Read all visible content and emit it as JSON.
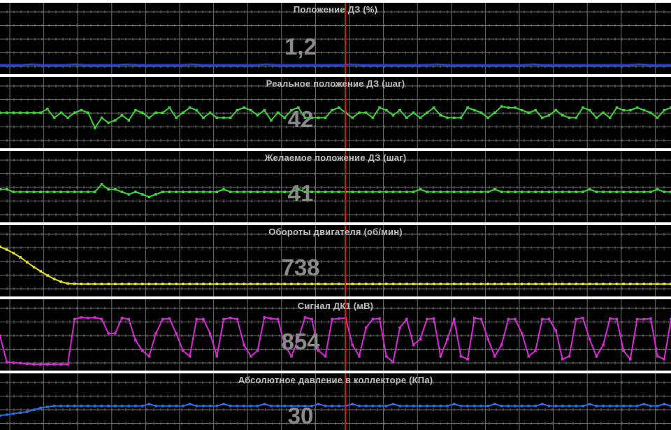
{
  "colors": {
    "background": "#000000",
    "grid": "#6e6e6e",
    "separator": "#ffffff",
    "cursor": "#e01010",
    "title": "#bdbdbd",
    "value": "#8a8a8a"
  },
  "panels": [
    {
      "title": "Положение ДЗ  (%)",
      "value": "1,2",
      "color": "#1c3fe6",
      "marker": false,
      "ymin": 0,
      "ymax": 10,
      "data": [
        1,
        1,
        1,
        1.1,
        1,
        1,
        1,
        1.1,
        1,
        1,
        1,
        1,
        1.1,
        1,
        1,
        1,
        1,
        1,
        1.1,
        1,
        1,
        1,
        1,
        1,
        1,
        1.1,
        1,
        1,
        1,
        1,
        1,
        1,
        1,
        1.1,
        1,
        1,
        1,
        1,
        1,
        1,
        1,
        1.1,
        1,
        1,
        1,
        1,
        1,
        1,
        1,
        1,
        1.1,
        1,
        1,
        1,
        1,
        1,
        1,
        1,
        1,
        1,
        1.1,
        1,
        1,
        1
      ]
    },
    {
      "title": "Реальное положение ДЗ  (шаг)",
      "value": "42",
      "color": "#3fd23a",
      "marker": true,
      "ymin": 30,
      "ymax": 55,
      "data": [
        43,
        43,
        43,
        43,
        43,
        43,
        43,
        44.5,
        41,
        43,
        41,
        43,
        44,
        43,
        37,
        41,
        39,
        40,
        42,
        40,
        44,
        43,
        41,
        43,
        43,
        45,
        41,
        43,
        45,
        44,
        41,
        43,
        41,
        41,
        41,
        44,
        45,
        44,
        42,
        44,
        40,
        43,
        41,
        44,
        45,
        41,
        41,
        41,
        41,
        44,
        45,
        43,
        41,
        43,
        43,
        41,
        45,
        44,
        42,
        44,
        41,
        43,
        41,
        43,
        45,
        42,
        41,
        41,
        41,
        45,
        44,
        43,
        41,
        43,
        45.5,
        45,
        45,
        44,
        43,
        44,
        41,
        42,
        44,
        42,
        41,
        41,
        45,
        44,
        41,
        43,
        41,
        45,
        44,
        44,
        45,
        44,
        43,
        41,
        44,
        45
      ]
    },
    {
      "title": "Желаемое положение ДЗ  (шаг)",
      "value": "41",
      "color": "#3fd23a",
      "marker": true,
      "ymin": 30,
      "ymax": 55,
      "data": [
        42,
        42,
        41,
        41,
        41,
        41,
        41,
        41,
        41,
        41,
        41,
        41,
        41,
        41,
        41,
        44,
        42,
        42,
        41,
        40,
        41,
        40,
        39,
        40,
        41,
        41,
        41,
        41,
        41,
        41,
        41,
        41,
        41,
        42,
        41,
        41,
        41,
        41,
        41,
        41,
        41,
        41,
        41,
        41,
        42,
        41,
        41,
        41,
        41,
        41,
        41,
        41,
        41,
        41,
        41,
        41,
        41,
        41,
        41,
        41,
        41,
        41,
        42,
        41,
        41,
        41,
        41,
        41,
        41,
        41,
        41,
        41,
        41,
        42,
        41,
        41,
        41,
        41,
        41,
        41,
        41,
        41,
        41,
        41,
        41,
        41,
        41,
        42,
        41,
        41,
        41,
        41,
        41,
        41,
        41,
        41,
        41,
        42,
        41,
        41
      ]
    },
    {
      "title": "Обороты двигателя  (об/мин)",
      "value": "738",
      "color": "#e6e21c",
      "marker": true,
      "ymin": 600,
      "ymax": 1500,
      "data": [
        1270,
        1230,
        1180,
        1120,
        1050,
        980,
        920,
        860,
        810,
        770,
        745,
        740,
        738,
        738,
        738,
        738,
        738,
        738,
        738,
        738,
        738,
        738,
        738,
        738,
        738,
        738,
        738,
        738,
        738,
        738,
        738,
        738,
        738,
        738,
        738,
        738,
        738,
        738,
        738,
        738,
        738,
        738,
        738,
        738,
        738,
        738,
        738,
        738,
        738,
        738,
        738,
        738,
        738,
        738,
        738,
        738,
        738,
        738,
        738,
        738,
        738,
        738,
        738,
        738,
        738,
        738,
        738,
        738,
        738,
        738,
        738,
        738,
        738,
        738,
        738,
        738,
        738,
        738,
        738,
        738,
        738,
        738,
        738,
        738,
        738,
        738,
        738,
        738,
        738,
        738,
        738,
        738,
        738,
        738,
        738,
        738,
        738,
        738,
        738,
        738
      ]
    },
    {
      "title": "Сигнал ДК1  (мВ)",
      "value": "854",
      "color": "#d62ad6",
      "marker": true,
      "ymin": 0,
      "ymax": 1100,
      "data": [
        560,
        100,
        90,
        80,
        70,
        60,
        60,
        60,
        60,
        60,
        60,
        850,
        880,
        870,
        880,
        850,
        600,
        600,
        870,
        850,
        480,
        300,
        200,
        600,
        850,
        860,
        600,
        300,
        200,
        850,
        850,
        600,
        200,
        850,
        870,
        850,
        400,
        200,
        300,
        880,
        860,
        850,
        400,
        200,
        500,
        880,
        850,
        300,
        200,
        850,
        860,
        870,
        400,
        200,
        700,
        850,
        860,
        200,
        100,
        700,
        850,
        400,
        500,
        850,
        860,
        200,
        500,
        850,
        200,
        150,
        870,
        850,
        500,
        200,
        400,
        850,
        850,
        600,
        200,
        300,
        850,
        850,
        650,
        150,
        200,
        850,
        870,
        500,
        200,
        400,
        860,
        850,
        300,
        150,
        850,
        850,
        860,
        200,
        150,
        850
      ]
    },
    {
      "title": "Абсолютное давление в коллекторе  (КПа)",
      "value": "30",
      "color": "#2a6fe0",
      "marker": true,
      "ymin": 20,
      "ymax": 45,
      "data": [
        26,
        26.5,
        27,
        27.5,
        28,
        29,
        30,
        30.5,
        31,
        31,
        31,
        31,
        31,
        31,
        31,
        31,
        31,
        31,
        31,
        31,
        31,
        31,
        32,
        31,
        31,
        31,
        31,
        31,
        32,
        31,
        31,
        31,
        31,
        32,
        31,
        31,
        31,
        31,
        31,
        32,
        31,
        31,
        31,
        31,
        31,
        31,
        31,
        32,
        31,
        31,
        31,
        31,
        32,
        31,
        31,
        31,
        31,
        31,
        32,
        31,
        31,
        31,
        31,
        31,
        31,
        31,
        31,
        32,
        31,
        31,
        31,
        31,
        31,
        32,
        31,
        31,
        31,
        31,
        31,
        31,
        32,
        31,
        31,
        31,
        31,
        31,
        31,
        32,
        31,
        31,
        31,
        31,
        31,
        31,
        31,
        32,
        31,
        31,
        32,
        31
      ]
    }
  ]
}
